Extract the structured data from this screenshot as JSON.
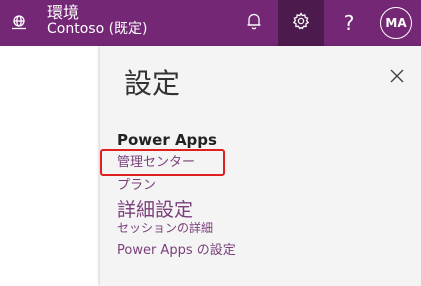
{
  "header": {
    "environment_label": "環境",
    "environment_name": "Contoso (既定)",
    "help_glyph": "?",
    "avatar_initials": "MA",
    "bar_color": "#742774",
    "active_button_color": "#4d1a4d"
  },
  "settings_panel": {
    "title": "設定",
    "section_heading": "Power Apps",
    "links": [
      {
        "label": "管理センター"
      },
      {
        "label": "プラン"
      },
      {
        "label": "詳細設定"
      },
      {
        "label": "セッションの詳細"
      },
      {
        "label": "Power Apps の設定"
      }
    ],
    "highlighted_link": "管理センター",
    "highlight_color": "#e02020"
  },
  "icons": [
    "environment-icon",
    "bell-icon",
    "gear-icon",
    "help-icon",
    "close-icon"
  ]
}
